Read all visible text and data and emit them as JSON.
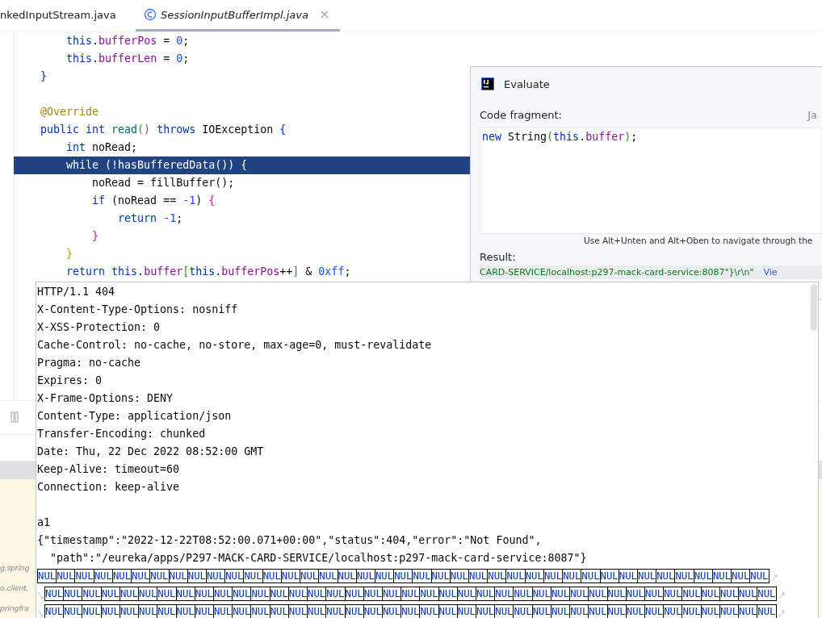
{
  "editor": {
    "tabs": [
      {
        "label": "nkedInputStream.java",
        "selected": false,
        "kind": "plain"
      },
      {
        "label": "SessionInputBufferImpl.java",
        "selected": true,
        "kind": "class"
      }
    ],
    "code_lines": [
      {
        "highlighted": false,
        "tokens": [
          {
            "t": "        this",
            "kind": "kw"
          },
          {
            "t": ".",
            "kind": "plain"
          },
          {
            "t": "bufferPos",
            "kind": "field"
          },
          {
            "t": " = ",
            "kind": "plain"
          },
          {
            "t": "0",
            "kind": "num"
          },
          {
            "t": ";",
            "kind": "plain"
          }
        ]
      },
      {
        "highlighted": false,
        "tokens": [
          {
            "t": "        this",
            "kind": "kw"
          },
          {
            "t": ".",
            "kind": "plain"
          },
          {
            "t": "bufferLen",
            "kind": "field"
          },
          {
            "t": " = ",
            "kind": "plain"
          },
          {
            "t": "0",
            "kind": "num"
          },
          {
            "t": ";",
            "kind": "plain"
          }
        ]
      },
      {
        "highlighted": false,
        "tokens": [
          {
            "t": "    }",
            "kind": "brace1"
          }
        ]
      },
      {
        "highlighted": false,
        "gap_before": true,
        "tokens": [
          {
            "t": "    @Override",
            "kind": "annot"
          }
        ]
      },
      {
        "highlighted": false,
        "tokens": [
          {
            "t": "    public int",
            "kind": "kw"
          },
          {
            "t": " read",
            "kind": "method"
          },
          {
            "t": "()",
            "kind": "brace3"
          },
          {
            "t": " throws",
            "kind": "kw"
          },
          {
            "t": " IOException ",
            "kind": "plain"
          },
          {
            "t": "{",
            "kind": "brace1"
          }
        ]
      },
      {
        "highlighted": false,
        "tokens": [
          {
            "t": "        int",
            "kind": "kw"
          },
          {
            "t": " noRead;",
            "kind": "plain"
          }
        ]
      },
      {
        "highlighted": true,
        "tokens": [
          {
            "t": "        while (!hasBufferedData()) {",
            "kind": "plain"
          }
        ]
      },
      {
        "highlighted": false,
        "tokens": [
          {
            "t": "            noRead = fillBuffer();",
            "kind": "plain"
          }
        ]
      },
      {
        "highlighted": false,
        "tokens": [
          {
            "t": "            if",
            "kind": "kw"
          },
          {
            "t": " (noRead == ",
            "kind": "plain"
          },
          {
            "t": "-1",
            "kind": "num"
          },
          {
            "t": ") ",
            "kind": "plain"
          },
          {
            "t": "{",
            "kind": "brace2"
          }
        ]
      },
      {
        "highlighted": false,
        "tokens": [
          {
            "t": "                return",
            "kind": "kw"
          },
          {
            "t": " -1",
            "kind": "num"
          },
          {
            "t": ";",
            "kind": "plain"
          }
        ]
      },
      {
        "highlighted": false,
        "tokens": [
          {
            "t": "            }",
            "kind": "brace2"
          }
        ]
      },
      {
        "highlighted": false,
        "tokens": [
          {
            "t": "        }",
            "kind": "brace4"
          }
        ]
      },
      {
        "highlighted": false,
        "tokens": [
          {
            "t": "        return this",
            "kind": "kw"
          },
          {
            "t": ".",
            "kind": "plain"
          },
          {
            "t": "buffer",
            "kind": "field"
          },
          {
            "t": "[",
            "kind": "brace3"
          },
          {
            "t": "this",
            "kind": "kw"
          },
          {
            "t": ".",
            "kind": "plain"
          },
          {
            "t": "bufferPos",
            "kind": "field"
          },
          {
            "t": "++",
            "kind": "plain"
          },
          {
            "t": "]",
            "kind": "brace3"
          },
          {
            "t": " & ",
            "kind": "plain"
          },
          {
            "t": "0xff",
            "kind": "num"
          },
          {
            "t": ";",
            "kind": "plain"
          }
        ]
      }
    ]
  },
  "debug_panel": {
    "frames": [
      "g.spring",
      "o.client,",
      "pringfra"
    ]
  },
  "evaluate_dialog": {
    "title": "Evaluate",
    "code_label": "Code fragment:",
    "language": "Ja",
    "code_tokens": [
      {
        "t": "new",
        "kind": "kw"
      },
      {
        "t": " String",
        "kind": "plain"
      },
      {
        "t": "(",
        "kind": "brace3"
      },
      {
        "t": "this",
        "kind": "kw"
      },
      {
        "t": ".",
        "kind": "plain"
      },
      {
        "t": "buffer",
        "kind": "field"
      },
      {
        "t": ")",
        "kind": "brace3"
      },
      {
        "t": ";",
        "kind": "plain"
      }
    ],
    "hint": "Use Alt+Unten and Alt+Oben to navigate through the",
    "result_label": "Result:",
    "result_value": "CARD-SERVICE/localhost:p297-mack-card-service:8087\"}\\r\\n\"",
    "result_link": "Vie"
  },
  "response_popup": {
    "header_lines": [
      "HTTP/1.1 404",
      "X-Content-Type-Options: nosniff",
      "X-XSS-Protection: 0",
      "Cache-Control: no-cache, no-store, max-age=0, must-revalidate",
      "Pragma: no-cache",
      "Expires: 0",
      "X-Frame-Options: DENY",
      "Content-Type: application/json",
      "Transfer-Encoding: chunked",
      "Date: Thu, 22 Dec 2022 08:52:00 GMT",
      "Keep-Alive: timeout=60",
      "Connection: keep-alive"
    ],
    "body_lines": [
      "a1",
      "{\"timestamp\":\"2022-12-22T08:52:00.071+00:00\",\"status\":404,\"error\":\"Not Found\",",
      "  \"path\":\"/eureka/apps/P297-MACK-CARD-SERVICE/localhost:p297-mack-card-service:8087\"}"
    ],
    "nul_rows": [
      {
        "continued": false,
        "chars": [
          "NUL",
          "NUL",
          "NUL",
          "NUL",
          "NUL",
          "NUL",
          "NUL",
          "NUL",
          "NUL",
          "NUL",
          "NUL",
          "NUL",
          "NUL",
          "NUL",
          "NUL",
          "NUL",
          "NUL",
          "NUL",
          "NUL",
          "NUL",
          "NUL",
          "NUL",
          "NUL",
          "NUL",
          "NUL",
          "NUL",
          "NUL",
          "NUL",
          "NUL",
          "NUL",
          "NUL",
          "NUL",
          "NUL",
          "NUL",
          "NUL",
          "NUL",
          "NUL",
          "NUL",
          "NUL"
        ]
      },
      {
        "continued": true,
        "chars": [
          "NUL",
          "NUL",
          "NUL",
          "NUL",
          "NUL",
          "NUL",
          "NUL",
          "NUL",
          "NUL",
          "NUL",
          "NUL",
          "NUL",
          "NUL",
          "NUL",
          "NUL",
          "NUL",
          "NUL",
          "NUL",
          "NUL",
          "NUL",
          "NUL",
          "NUL",
          "NUL",
          "NUL",
          "NUL",
          "NUL",
          "NUL",
          "NUL",
          "NUL",
          "NUL",
          "NUL",
          "NUL",
          "NUL",
          "NUL",
          "NUL",
          "NUL",
          "NUL",
          "NUL",
          "NUL"
        ]
      },
      {
        "continued": true,
        "chars": [
          "NUL",
          "NUL",
          "NUL",
          "NUL",
          "NUL",
          "NUL",
          "NUL",
          "NUL",
          "NUL",
          "NUL",
          "NUL",
          "NUL",
          "NUL",
          "NUL",
          "NUL",
          "NUL",
          "NUL",
          "NUL",
          "NUL",
          "NUL",
          "NUL",
          "NUL",
          "NUL",
          "NUL",
          "NUL",
          "NUL",
          "NUL",
          "NUL",
          "NUL",
          "NUL",
          "NUL",
          "NUL",
          "NUL",
          "NUL",
          "NUL",
          "NUL",
          "NUL",
          "NUL",
          "NUL"
        ]
      }
    ]
  }
}
